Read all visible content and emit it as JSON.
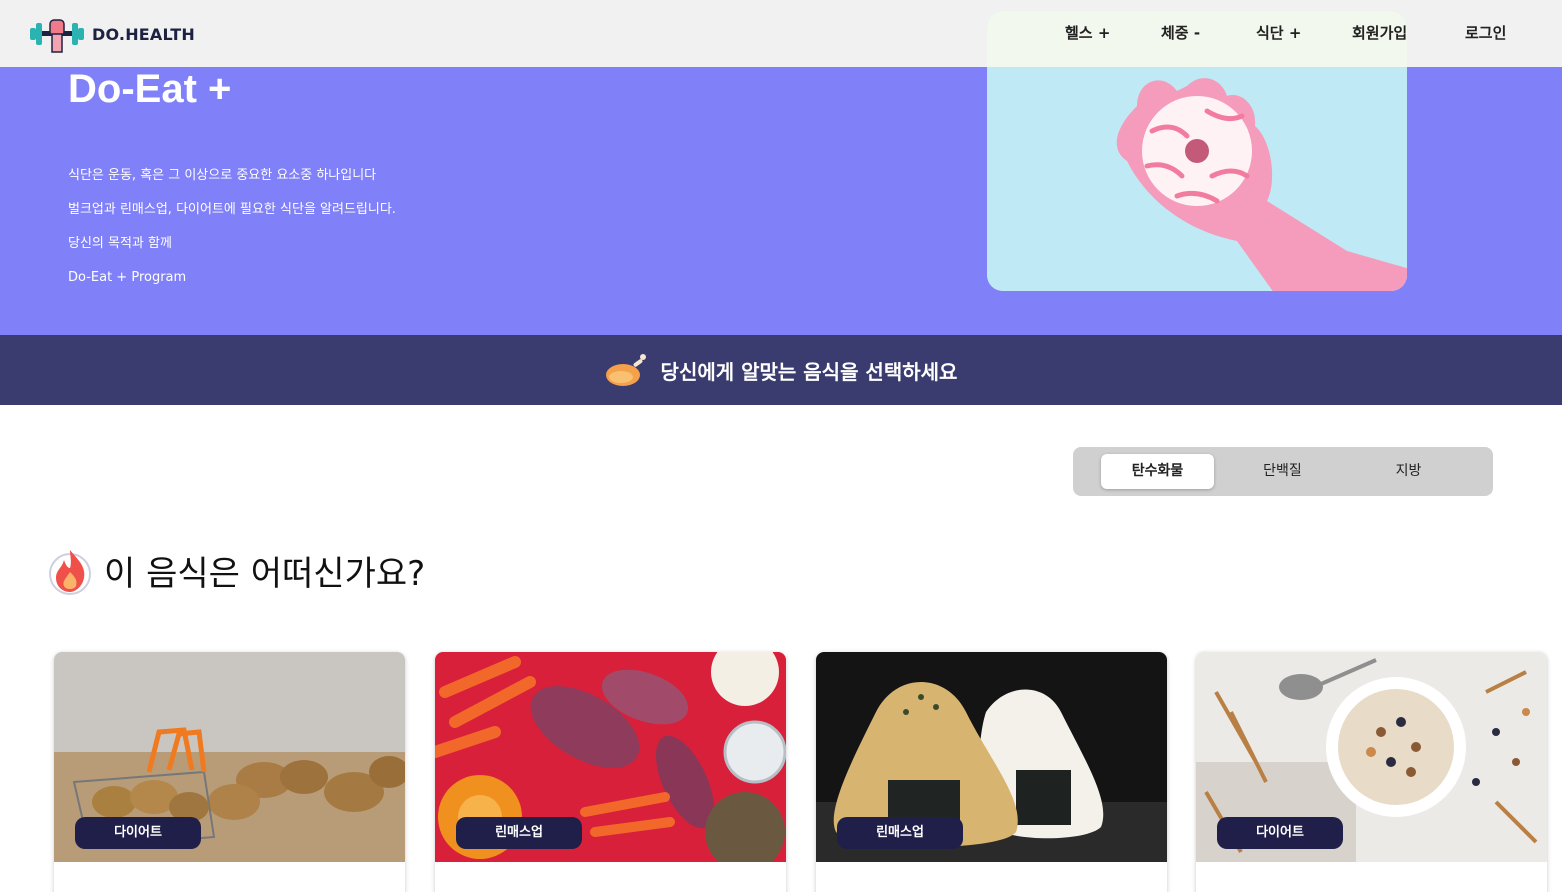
{
  "header": {
    "logo_text": "DO.HEALTH",
    "nav": [
      "헬스 +",
      "체중 -",
      "식단 +",
      "회원가입",
      "로그인"
    ]
  },
  "hero": {
    "title": "Do-Eat +",
    "lines": [
      "식단은 운동, 혹은 그 이상으로 중요한 요소중 하나입니다",
      "벌크업과 린매스업, 다이어트에 필요한 식단을 알려드립니다.",
      "당신의 목적과 함께",
      "Do-Eat + Program"
    ]
  },
  "banner": {
    "text": "당신에게 알맞는 음식을 선택하세요"
  },
  "tabs": {
    "items": [
      "탄수화물",
      "단백질",
      "지방"
    ],
    "active": "탄수화물"
  },
  "section": {
    "title": "이 음식은 어떠신가요?"
  },
  "cards": [
    {
      "badge": "다이어트",
      "image": "potatoes"
    },
    {
      "badge": "린매스업",
      "image": "sweet-potatoes"
    },
    {
      "badge": "린매스업",
      "image": "rice-balls"
    },
    {
      "badge": "다이어트",
      "image": "oatmeal"
    }
  ],
  "colors": {
    "hero": "#8080f8",
    "banner": "#3a3b6e",
    "badge": "#1f1f4a"
  }
}
